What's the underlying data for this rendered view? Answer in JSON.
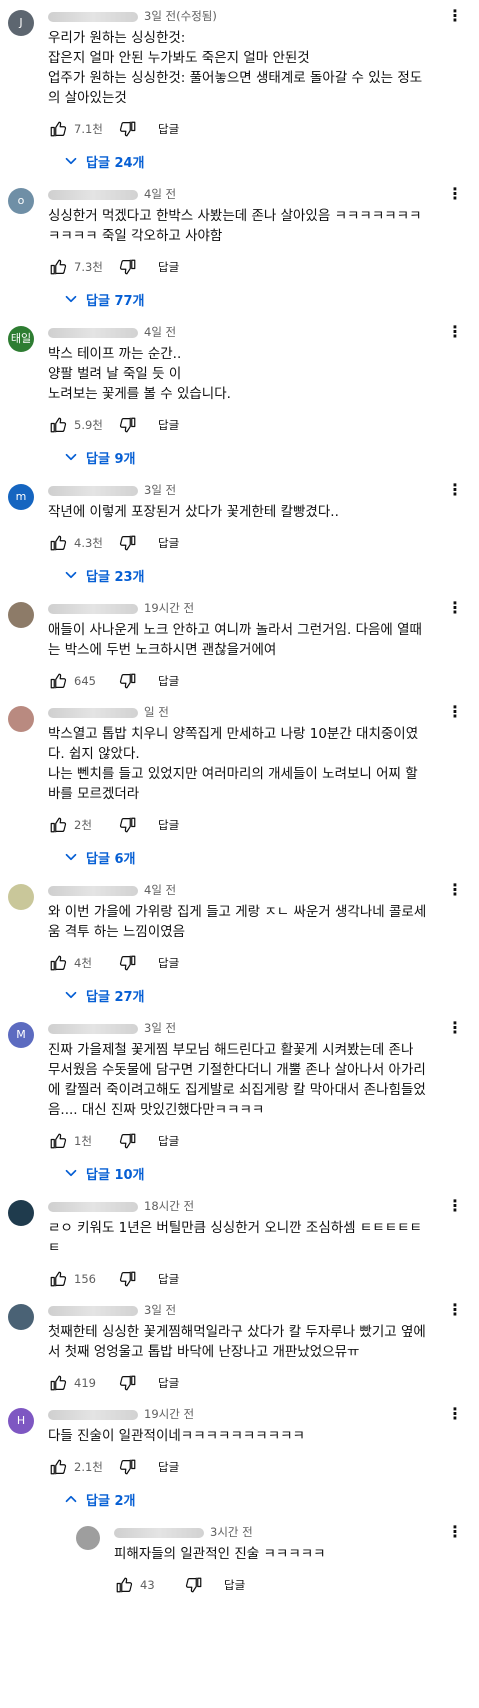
{
  "comments": [
    {
      "avatar_letter": "J",
      "avatar_color": "#5d6670",
      "time": "3일 전(수정됨)",
      "text": "우리가 원하는 싱싱한것:\n잡은지 얼마 안된 누가봐도 죽은지 얼마 안된것\n업주가 원하는 싱싱한것: 풀어놓으면 생태계로 돌아갈 수 있는 정도의 살아있는것",
      "likes": "7.1천",
      "reply_label": "답글",
      "replies_label": "답글 24개",
      "reply_chevron": "chevron-down"
    },
    {
      "avatar_letter": "o",
      "avatar_color": "#6f8fa6",
      "time": "4일 전",
      "text": "싱싱한거 먹겠다고 한박스 사봤는데 존나 살아있음 ㅋㅋㅋㅋㅋㅋㅋㅋㅋㅋㅋ 죽일 각오하고 사야함",
      "likes": "7.3천",
      "reply_label": "답글",
      "replies_label": "답글 77개",
      "reply_chevron": "chevron-down"
    },
    {
      "avatar_letter": "태일",
      "avatar_color": "#2e7d32",
      "time": "4일 전",
      "text": "박스 테이프 까는 순간..\n양팔 벌려 날 죽일 듯 이\n노려보는 꽃게를 볼 수 있습니다.",
      "likes": "5.9천",
      "reply_label": "답글",
      "replies_label": "답글 9개",
      "reply_chevron": "chevron-down"
    },
    {
      "avatar_letter": "m",
      "avatar_color": "#1565c0",
      "time": "3일 전",
      "text": "작년에 이렇게 포장된거 샀다가 꽃게한테 칼빵겼다..",
      "likes": "4.3천",
      "reply_label": "답글",
      "replies_label": "답글 23개",
      "reply_chevron": "chevron-down"
    },
    {
      "avatar_letter": "",
      "avatar_color": "#8d7b68",
      "time": "19시간 전",
      "text": "애들이 사나운게 노크 안하고 여니까 놀라서 그런거임. 다음에 열때는 박스에 두번 노크하시면 괜찮을거에여",
      "likes": "645",
      "reply_label": "답글",
      "replies_label": "",
      "reply_chevron": ""
    },
    {
      "avatar_letter": "",
      "avatar_color": "#b98a80",
      "time": "일 전",
      "text": "박스열고 톱밥 치우니 양쪽집게 만세하고 나랑 10분간 대치중이였다. 쉽지 않았다.\n나는 뻰치를 들고 있었지만 여러마리의 개세들이 노려보니 어찌 할바를 모르겠더라",
      "likes": "2천",
      "reply_label": "답글",
      "replies_label": "답글 6개",
      "reply_chevron": "chevron-down"
    },
    {
      "avatar_letter": "",
      "avatar_color": "#c9c79a",
      "time": "4일 전",
      "text": "와 이번 가을에 가위랑 집게 들고 게랑 ㅈㄴ 싸운거 생각나네 콜로세움 격투 하는 느낌이였음",
      "likes": "4천",
      "reply_label": "답글",
      "replies_label": "답글 27개",
      "reply_chevron": "chevron-down"
    },
    {
      "avatar_letter": "M",
      "avatar_color": "#5c6bc0",
      "time": "3일 전",
      "text": "진짜 가을제철 꽃게찜 부모님 해드린다고 활꽃게 시켜봤는데 존나 무서웠음 수돗물에 담구면 기절한다더니 개뿔 존나 살아나서 아가리에 칼찔러 죽이려고해도 집게발로 쇠집게랑 칼 막아대서 존나힘들었음.... 대신 진짜 맛있긴했다만ㅋㅋㅋㅋ",
      "likes": "1천",
      "reply_label": "답글",
      "replies_label": "답글 10개",
      "reply_chevron": "chevron-down"
    },
    {
      "avatar_letter": "",
      "avatar_color": "#1f3b4d",
      "time": "18시간 전",
      "text": "ㄹㅇ 키워도 1년은 버틸만큼 싱싱한거 오니깐 조심하셈 ㅌㅌㅌㅌㅌㅌ",
      "likes": "156",
      "reply_label": "답글",
      "replies_label": "",
      "reply_chevron": ""
    },
    {
      "avatar_letter": "",
      "avatar_color": "#4a6275",
      "time": "3일 전",
      "text": "첫째한테 싱싱한 꽃게찜해먹일라구 샀다가 칼 두자루나 빴기고 옆에서 첫째 엉엉울고 톱밥 바닥에 난장나고 개판났었으뮤ㅠ",
      "likes": "419",
      "reply_label": "답글",
      "replies_label": "",
      "reply_chevron": ""
    },
    {
      "avatar_letter": "H",
      "avatar_color": "#7e57c2",
      "time": "19시간 전",
      "text": "다들 진술이 일관적이네ㅋㅋㅋㅋㅋㅋㅋㅋㅋㅋ",
      "likes": "2.1천",
      "reply_label": "답글",
      "replies_label": "답글 2개",
      "reply_chevron": "chevron-up"
    },
    {
      "avatar_letter": "",
      "avatar_color": "#9e9e9e",
      "time": "3시간 전",
      "text": "피해자들의 일관적인 진술 ㅋㅋㅋㅋㅋ",
      "likes": "43",
      "reply_label": "답글",
      "replies_label": "",
      "reply_chevron": "",
      "is_reply": true
    }
  ]
}
